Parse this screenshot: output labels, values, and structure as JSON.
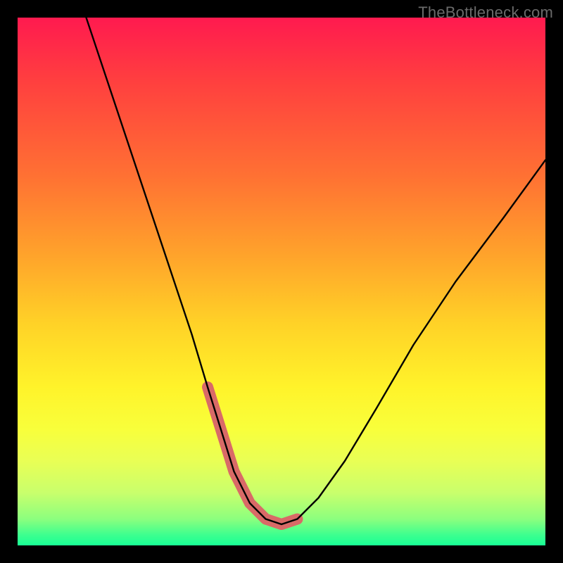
{
  "watermark": "TheBottleneck.com",
  "chart_data": {
    "type": "line",
    "title": "",
    "xlabel": "",
    "ylabel": "",
    "xlim": [
      0,
      100
    ],
    "ylim": [
      0,
      100
    ],
    "series": [
      {
        "name": "bottleneck-curve",
        "x": [
          13,
          17,
          21,
          25,
          29,
          33,
          36,
          38.5,
          41,
          44,
          47,
          50,
          53,
          57,
          62,
          68,
          75,
          83,
          92,
          100
        ],
        "values": [
          100,
          88,
          76,
          64,
          52,
          40,
          30,
          22,
          14,
          8,
          5,
          4,
          5,
          9,
          16,
          26,
          38,
          50,
          62,
          73
        ]
      }
    ],
    "highlight": {
      "name": "valley-band",
      "x": [
        36,
        38.5,
        41,
        44,
        47,
        50,
        53
      ],
      "values": [
        30,
        22,
        14,
        8,
        5,
        4,
        5
      ],
      "color": "#d96a67",
      "stroke_width_px": 16
    },
    "colors": {
      "curve": "#000000",
      "highlight": "#d96a67",
      "frame": "#000000"
    }
  }
}
